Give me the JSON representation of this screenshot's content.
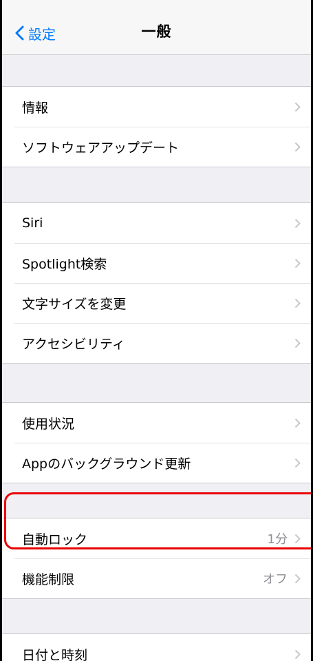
{
  "nav": {
    "back_label": "設定",
    "title": "一般"
  },
  "groups": [
    {
      "rows": [
        {
          "label": "情報"
        },
        {
          "label": "ソフトウェアアップデート"
        }
      ]
    },
    {
      "rows": [
        {
          "label": "Siri"
        },
        {
          "label": "Spotlight検索"
        },
        {
          "label": "文字サイズを変更"
        },
        {
          "label": "アクセシビリティ"
        }
      ]
    },
    {
      "rows": [
        {
          "label": "使用状況"
        },
        {
          "label": "Appのバックグラウンド更新"
        }
      ]
    },
    {
      "rows": [
        {
          "label": "自動ロック",
          "value": "1分"
        },
        {
          "label": "機能制限",
          "value": "オフ"
        }
      ]
    },
    {
      "rows": [
        {
          "label": "日付と時刻"
        }
      ]
    }
  ],
  "colors": {
    "accent": "#007aff",
    "highlight": "#ea0000",
    "chevron": "#c7c7cc",
    "background": "#efeff4"
  },
  "icons": {
    "back": "chevron-left-icon",
    "disclosure": "chevron-right-icon"
  }
}
